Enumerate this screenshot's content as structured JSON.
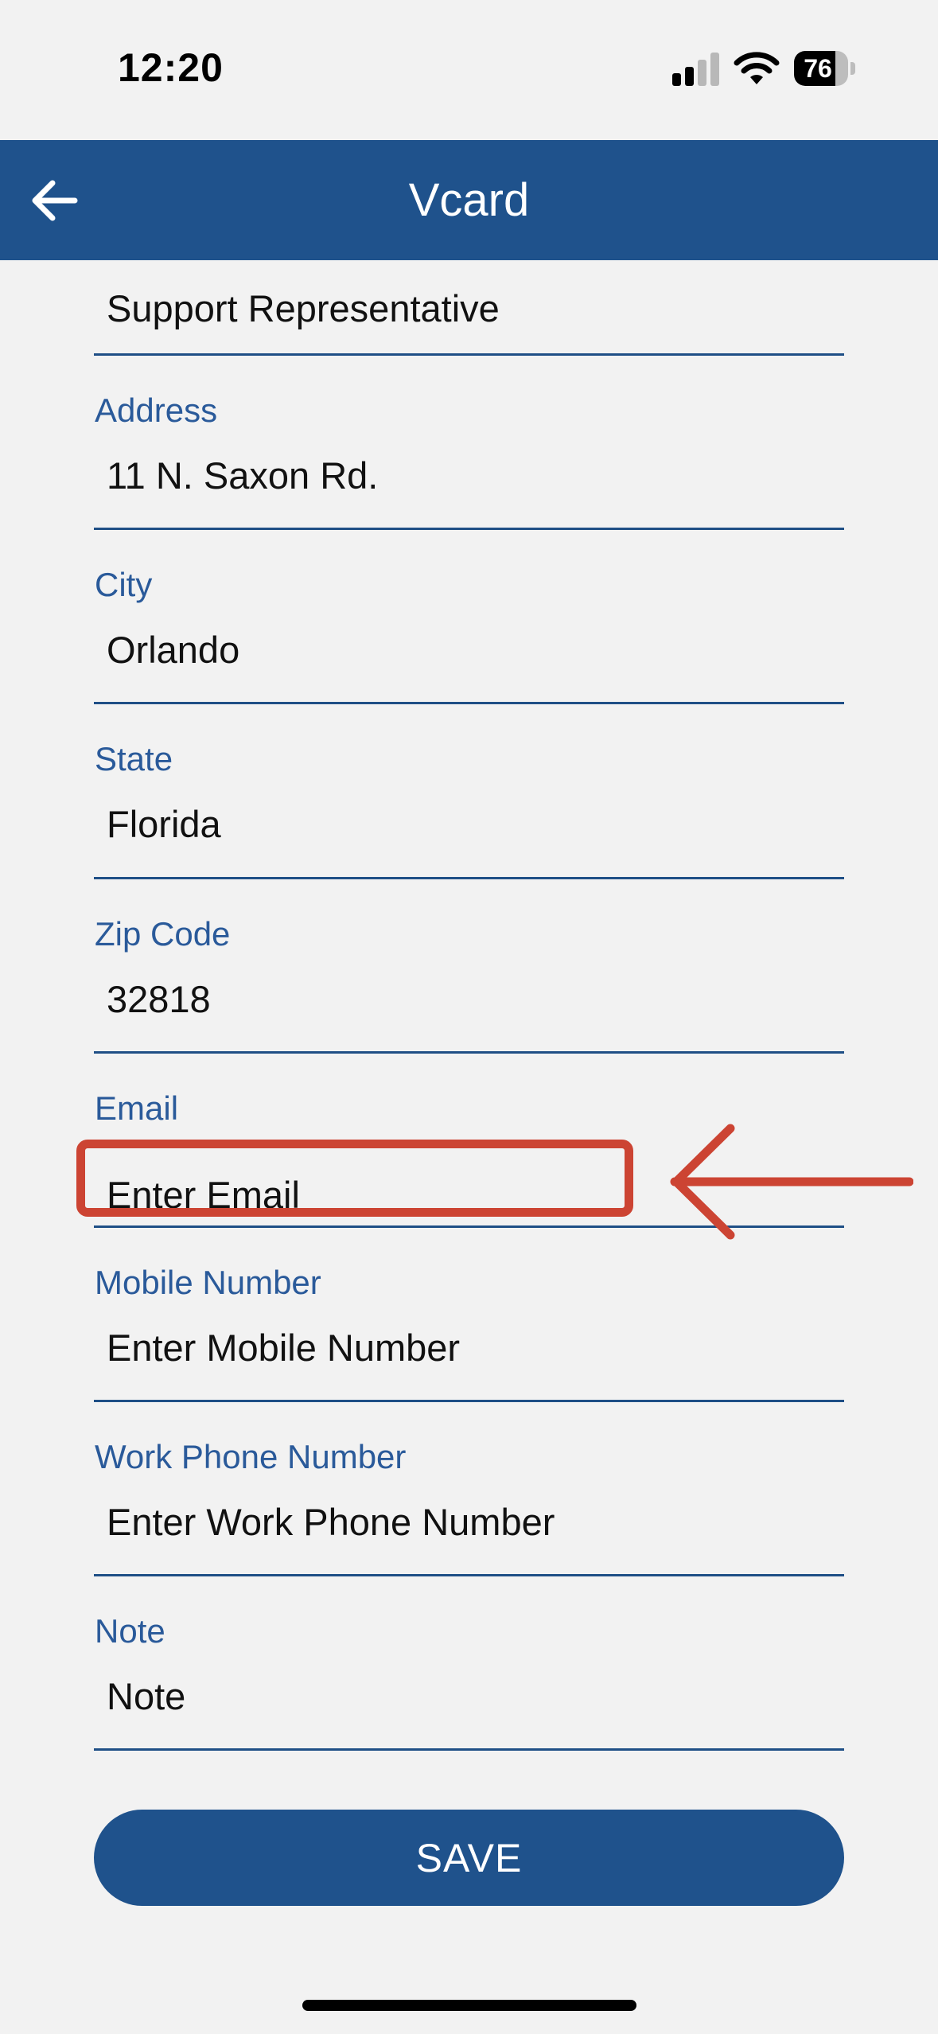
{
  "status_bar": {
    "time": "12:20",
    "battery_percent": 76,
    "battery_label": "76",
    "signal_icon": "cellular-signal-icon",
    "wifi_icon": "wifi-icon"
  },
  "app_bar": {
    "title": "Vcard",
    "back_icon": "arrow-left-icon",
    "background_color": "#1f528c"
  },
  "form": {
    "job_title": {
      "value": "Support Representative",
      "placeholder": ""
    },
    "address": {
      "label": "Address",
      "value": "11 N. Saxon Rd.",
      "placeholder": ""
    },
    "city": {
      "label": "City",
      "value": "Orlando",
      "placeholder": ""
    },
    "state": {
      "label": "State",
      "value": "Florida",
      "placeholder": ""
    },
    "zip_code": {
      "label": "Zip Code",
      "value": "32818",
      "placeholder": ""
    },
    "email": {
      "label": "Email",
      "value": "",
      "placeholder": "Enter Email"
    },
    "mobile_number": {
      "label": "Mobile Number",
      "value": "",
      "placeholder": "Enter Mobile Number"
    },
    "work_phone_number": {
      "label": "Work Phone Number",
      "value": "",
      "placeholder": "Enter Work Phone Number"
    },
    "note": {
      "label": "Note",
      "value": "",
      "placeholder": "Note"
    }
  },
  "save_button": {
    "label": "SAVE"
  },
  "annotation": {
    "highlight_color": "#cc4433",
    "arrow_icon": "arrow-left-annotation-icon"
  }
}
